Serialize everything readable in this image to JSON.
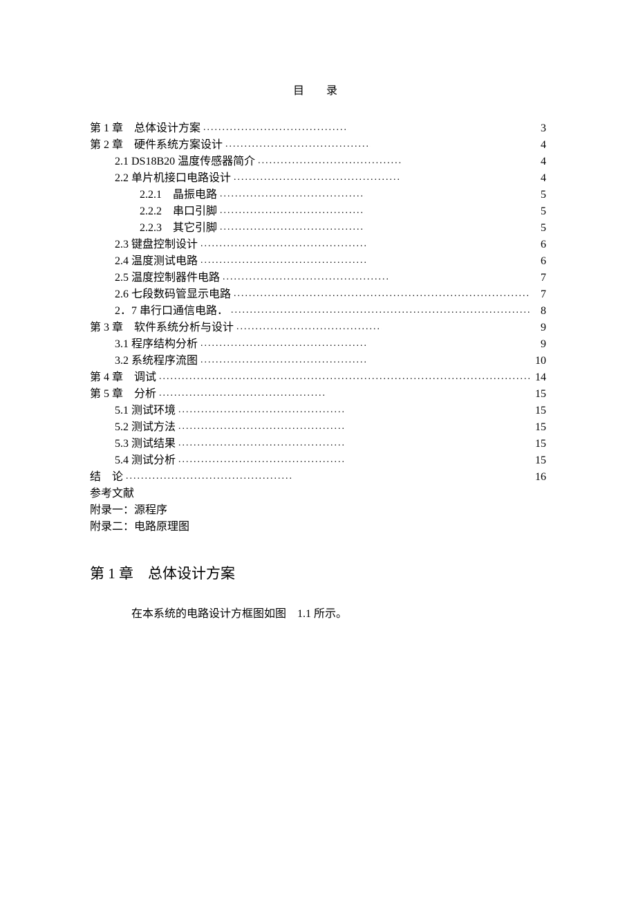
{
  "title": "目　录",
  "toc": [
    {
      "label": "第 1 章　总体设计方案",
      "page": "3",
      "indent": 0,
      "dots": "short"
    },
    {
      "label": "第 2 章　硬件系统方案设计",
      "page": "4",
      "indent": 0,
      "dots": "short"
    },
    {
      "label": "2.1 DS18B20 温度传感器简介",
      "page": "4",
      "indent": 1,
      "dots": "short"
    },
    {
      "label": "2.2 单片机接口电路设计",
      "page": "4",
      "indent": 1,
      "dots": "medium"
    },
    {
      "label": "2.2.1　晶振电路",
      "page": "5",
      "indent": 2,
      "dots": "short"
    },
    {
      "label": "2.2.2　串口引脚",
      "page": "5",
      "indent": 2,
      "dots": "short"
    },
    {
      "label": "2.2.3　其它引脚",
      "page": "5",
      "indent": 2,
      "dots": "short"
    },
    {
      "label": "2.3 键盘控制设计",
      "page": "6",
      "indent": 1,
      "dots": "medium"
    },
    {
      "label": "2.4 温度测试电路",
      "page": "6",
      "indent": 1,
      "dots": "medium"
    },
    {
      "label": "2.5 温度控制器件电路",
      "page": "7",
      "indent": 1,
      "dots": "medium"
    },
    {
      "label": "2.6 七段数码管显示电路",
      "page": "7",
      "indent": 1,
      "dots": "full"
    },
    {
      "label": "2．7 串行口通信电路．",
      "page": "8",
      "indent": 1,
      "dots": "full"
    },
    {
      "label": "第 3 章　软件系统分析与设计",
      "page": "9",
      "indent": 0,
      "dots": "short"
    },
    {
      "label": "3.1 程序结构分析",
      "page": "9",
      "indent": 1,
      "dots": "medium"
    },
    {
      "label": "3.2 系统程序流图",
      "page": "10",
      "indent": 1,
      "dots": "medium"
    },
    {
      "label": "第 4 章　调试",
      "page": "14",
      "indent": 0,
      "dots": "full"
    },
    {
      "label": "第 5 章　分析",
      "page": "15",
      "indent": 0,
      "dots": "medium"
    },
    {
      "label": "5.1 测试环境",
      "page": "15",
      "indent": 1,
      "dots": "medium"
    },
    {
      "label": "5.2 测试方法",
      "page": "15",
      "indent": 1,
      "dots": "medium"
    },
    {
      "label": "5.3 测试结果",
      "page": "15",
      "indent": 1,
      "dots": "medium"
    },
    {
      "label": "5.4 测试分析",
      "page": "15",
      "indent": 1,
      "dots": "medium"
    },
    {
      "label": "结　论",
      "page": "16",
      "indent": 0,
      "dots": "medium"
    }
  ],
  "extra": [
    "参考文献",
    "附录一：源程序",
    "附录二：电路原理图"
  ],
  "chapter_heading": "第 1 章　总体设计方案",
  "body_text": "在本系统的电路设计方框图如图　1.1 所示。"
}
